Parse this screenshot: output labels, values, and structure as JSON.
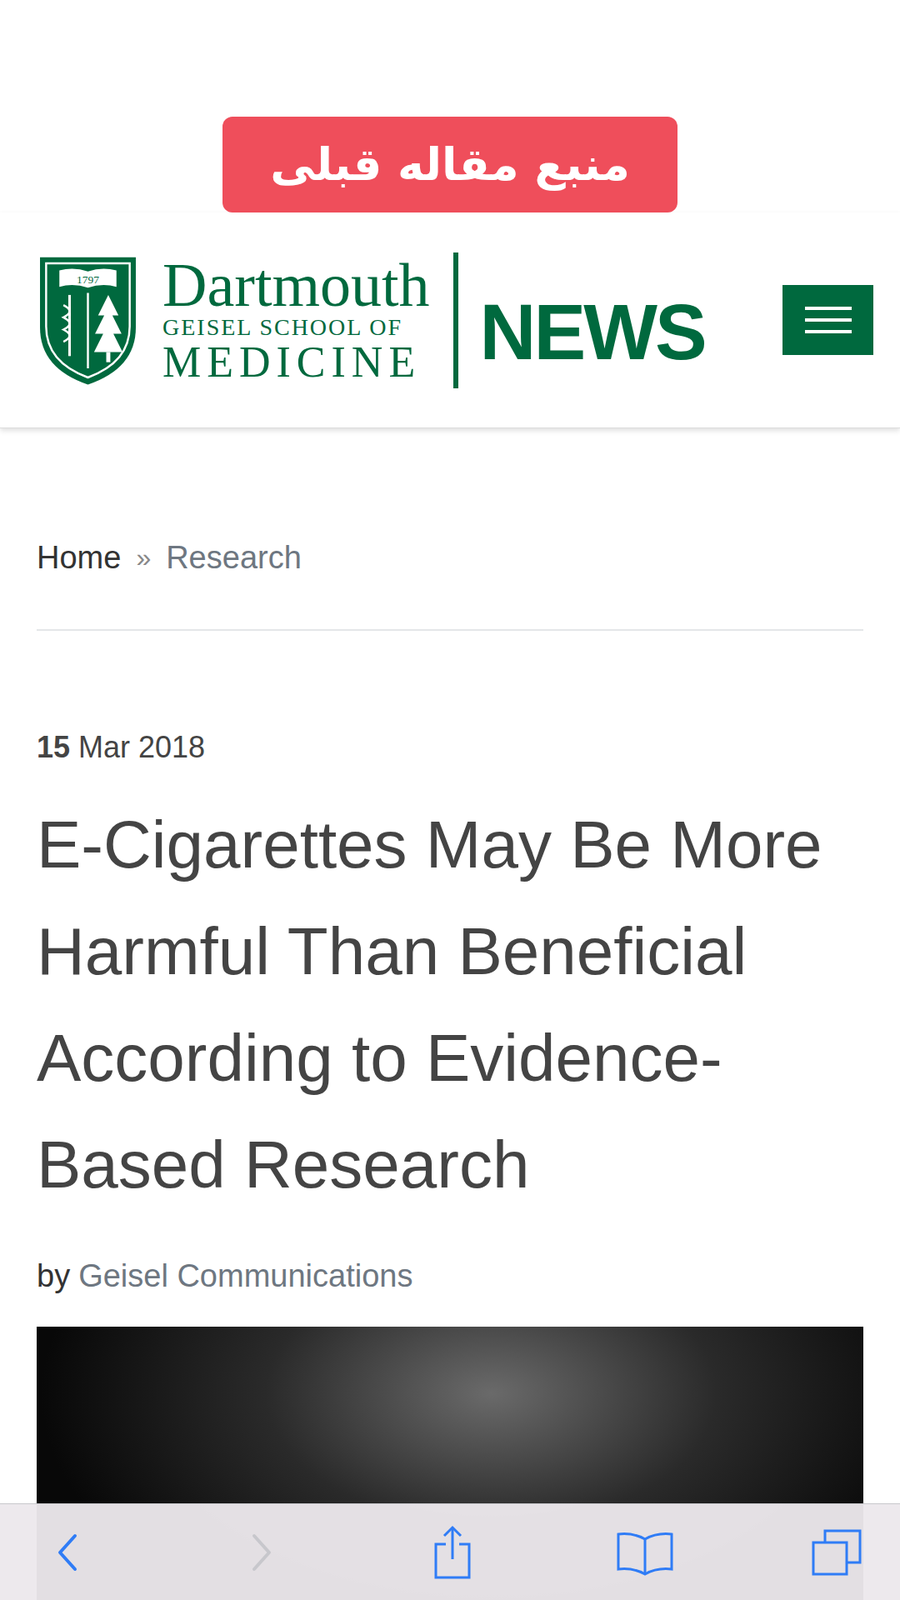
{
  "badge": {
    "text": "منبع مقاله قبلی"
  },
  "header": {
    "logo": {
      "year": "1797",
      "name": "Dartmouth",
      "school": "GEISEL SCHOOL OF",
      "field": "MEDICINE"
    },
    "section": "NEWS"
  },
  "breadcrumb": [
    "Home",
    "Research"
  ],
  "breadcrumb_separator": "»",
  "article": {
    "date": {
      "day": "15",
      "rest": "Mar 2018"
    },
    "title": "E-Cigarettes May Be More Harmful Than Beneficial According to Evidence-Based Research",
    "byline": {
      "prefix": "by",
      "author": "Geisel Communications"
    }
  },
  "toolbar": [
    {
      "kind": "back",
      "disabled": false
    },
    {
      "kind": "forward",
      "disabled": true
    },
    {
      "kind": "share",
      "disabled": false
    },
    {
      "kind": "bookmarks",
      "disabled": false
    },
    {
      "kind": "tabs",
      "disabled": false
    }
  ]
}
